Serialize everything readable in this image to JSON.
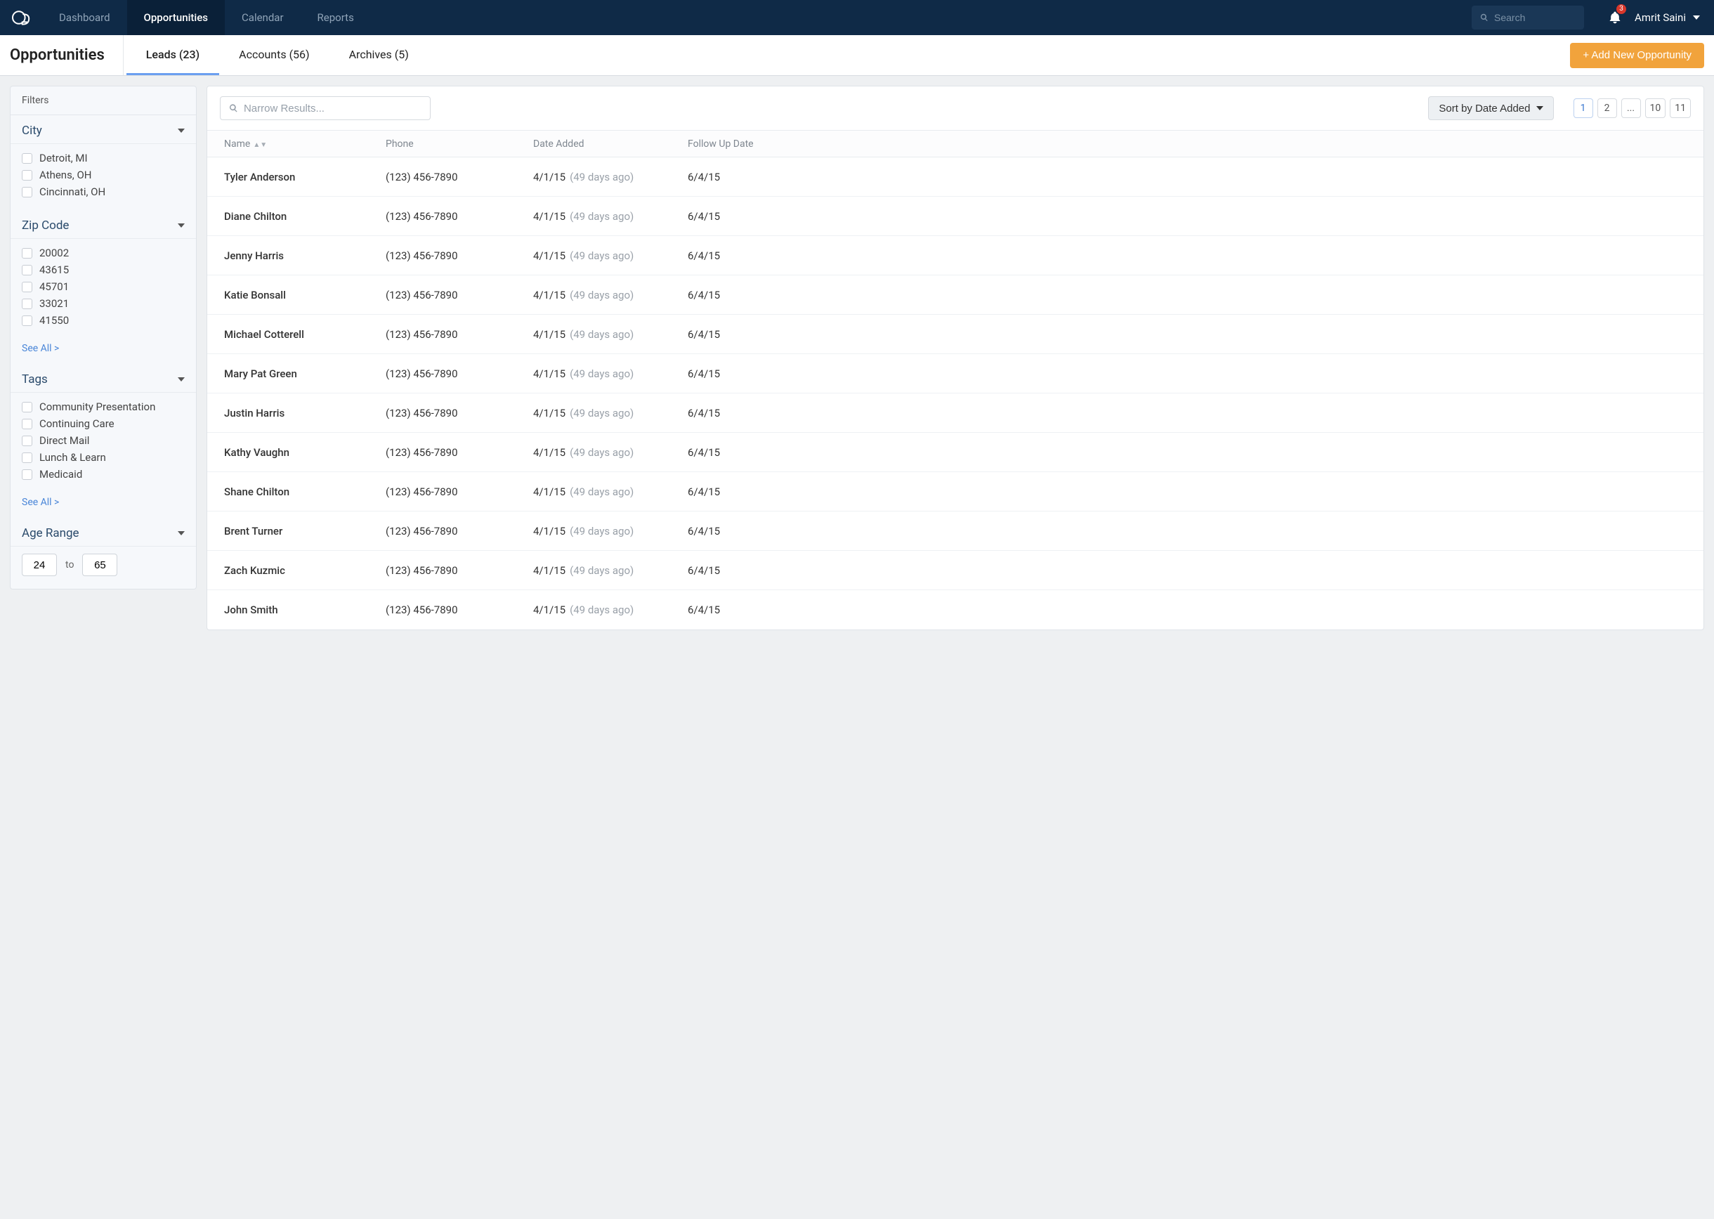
{
  "nav": {
    "items": [
      "Dashboard",
      "Opportunities",
      "Calendar",
      "Reports"
    ],
    "active_index": 1,
    "search_placeholder": "Search",
    "notification_count": "3",
    "user_name": "Amrit Saini"
  },
  "page": {
    "title": "Opportunities",
    "add_button": "+ Add New Opportunity",
    "tabs": [
      {
        "label": "Leads (23)",
        "active": true
      },
      {
        "label": "Accounts (56)",
        "active": false
      },
      {
        "label": "Archives (5)",
        "active": false
      }
    ]
  },
  "filters": {
    "header": "Filters",
    "city": {
      "title": "City",
      "options": [
        "Detroit, MI",
        "Athens, OH",
        "Cincinnati, OH"
      ]
    },
    "zip": {
      "title": "Zip Code",
      "options": [
        "20002",
        "43615",
        "45701",
        "33021",
        "41550"
      ],
      "see_all": "See All >"
    },
    "tags": {
      "title": "Tags",
      "options": [
        "Community Presentation",
        "Continuing Care",
        "Direct Mail",
        "Lunch & Learn",
        "Medicaid"
      ],
      "see_all": "See All >"
    },
    "age": {
      "title": "Age Range",
      "from": "24",
      "to_label": "to",
      "to": "65"
    }
  },
  "toolbar": {
    "narrow_placeholder": "Narrow Results...",
    "sort_label": "Sort by Date Added",
    "pages": [
      "1",
      "2",
      "...",
      "10",
      "11"
    ],
    "active_page_index": 0
  },
  "table": {
    "columns": [
      "Name",
      "Phone",
      "Date Added",
      "Follow Up Date"
    ],
    "rows": [
      {
        "name": "Tyler Anderson",
        "phone": "(123) 456-7890",
        "date": "4/1/15",
        "rel": "(49 days ago)",
        "follow": "6/4/15"
      },
      {
        "name": "Diane Chilton",
        "phone": "(123) 456-7890",
        "date": "4/1/15",
        "rel": "(49 days ago)",
        "follow": "6/4/15"
      },
      {
        "name": "Jenny Harris",
        "phone": "(123) 456-7890",
        "date": "4/1/15",
        "rel": "(49 days ago)",
        "follow": "6/4/15"
      },
      {
        "name": "Katie Bonsall",
        "phone": "(123) 456-7890",
        "date": "4/1/15",
        "rel": "(49 days ago)",
        "follow": "6/4/15"
      },
      {
        "name": "Michael Cotterell",
        "phone": "(123) 456-7890",
        "date": "4/1/15",
        "rel": "(49 days ago)",
        "follow": "6/4/15"
      },
      {
        "name": "Mary Pat Green",
        "phone": "(123) 456-7890",
        "date": "4/1/15",
        "rel": "(49 days ago)",
        "follow": "6/4/15"
      },
      {
        "name": "Justin Harris",
        "phone": "(123) 456-7890",
        "date": "4/1/15",
        "rel": "(49 days ago)",
        "follow": "6/4/15"
      },
      {
        "name": "Kathy Vaughn",
        "phone": "(123) 456-7890",
        "date": "4/1/15",
        "rel": "(49 days ago)",
        "follow": "6/4/15"
      },
      {
        "name": "Shane Chilton",
        "phone": "(123) 456-7890",
        "date": "4/1/15",
        "rel": "(49 days ago)",
        "follow": "6/4/15"
      },
      {
        "name": "Brent Turner",
        "phone": "(123) 456-7890",
        "date": "4/1/15",
        "rel": "(49 days ago)",
        "follow": "6/4/15"
      },
      {
        "name": "Zach Kuzmic",
        "phone": "(123) 456-7890",
        "date": "4/1/15",
        "rel": "(49 days ago)",
        "follow": "6/4/15"
      },
      {
        "name": "John Smith",
        "phone": "(123) 456-7890",
        "date": "4/1/15",
        "rel": "(49 days ago)",
        "follow": "6/4/15"
      }
    ]
  }
}
